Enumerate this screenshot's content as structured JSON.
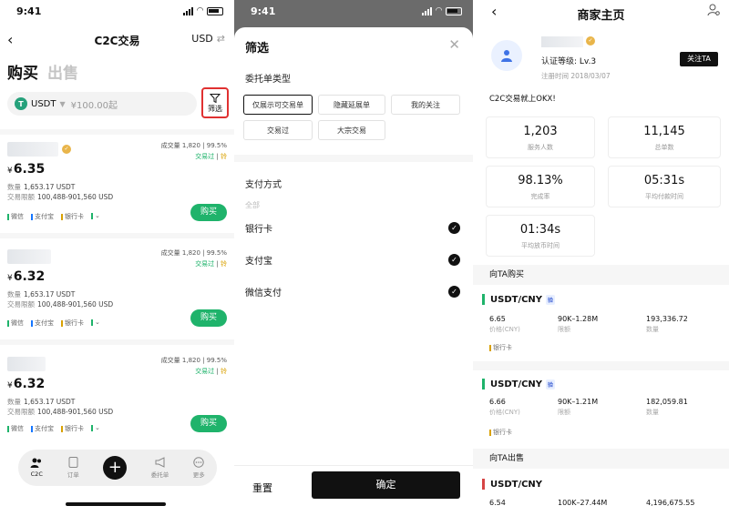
{
  "status": {
    "time": "9:41"
  },
  "list_screen": {
    "title": "C2C交易",
    "currency": "USD",
    "tabs": {
      "buy": "购买",
      "sell": "出售"
    },
    "search": {
      "asset": "USDT",
      "coin_letter": "T",
      "amount_placeholder": "¥100.00起"
    },
    "filter_label": "筛选",
    "ads": [
      {
        "volume": "成交量 1,820",
        "rate": "99.5%",
        "tag1": "交易过",
        "tag2": "铃",
        "currency_symbol": "¥",
        "price": "6.35",
        "qty_label": "数量",
        "qty": "1,653.17 USDT",
        "limit_label": "交易限额",
        "limit": "100,488-901,560 USD",
        "pays": [
          "微信",
          "支付宝",
          "银行卡"
        ],
        "buy": "购买"
      },
      {
        "volume": "成交量 1,820",
        "rate": "99.5%",
        "tag1": "交易过",
        "tag2": "铃",
        "currency_symbol": "¥",
        "price": "6.32",
        "qty_label": "数量",
        "qty": "1,653.17 USDT",
        "limit_label": "交易限额",
        "limit": "100,488-901,560 USD",
        "pays": [
          "微信",
          "支付宝",
          "银行卡"
        ],
        "buy": "购买"
      },
      {
        "volume": "成交量 1,820",
        "rate": "99.5%",
        "tag1": "交易过",
        "tag2": "铃",
        "currency_symbol": "¥",
        "price": "6.32",
        "qty_label": "数量",
        "qty": "1,653.17 USDT",
        "limit_label": "交易限额",
        "limit": "100,488-901,560 USD",
        "pays": [
          "微信",
          "支付宝",
          "银行卡"
        ],
        "buy": "购买"
      }
    ],
    "tabbar": {
      "c2c": "C2C",
      "orders": "订单",
      "ads": "委托单",
      "more": "更多"
    }
  },
  "filter_screen": {
    "title": "筛选",
    "order_type_label": "委托单类型",
    "chips": [
      "仅展示可交易单",
      "隐藏延展单",
      "我的关注",
      "交易过",
      "大宗交易"
    ],
    "payment_label": "支付方式",
    "payment_note": "全部",
    "payments": [
      "银行卡",
      "支付宝",
      "微信支付"
    ],
    "reset": "重置",
    "confirm": "确定"
  },
  "merchant_screen": {
    "title": "商家主页",
    "level_label": "认证等级:",
    "level": "Lv.3",
    "reg_label": "注册时间",
    "reg_date": "2018/03/07",
    "follow": "关注TA",
    "slogan": "C2C交易就上OKX!",
    "stats": [
      {
        "value": "1,203",
        "label": "服务人数"
      },
      {
        "value": "11,145",
        "label": "总单数"
      },
      {
        "value": "98.13%",
        "label": "完成率"
      },
      {
        "value": "05:31s",
        "label": "平均付款时间"
      },
      {
        "value": "01:34s",
        "label": "平均放币时间"
      }
    ],
    "buy_section": "向TA购买",
    "sell_section": "向TA出售",
    "tag": "验",
    "listings": [
      {
        "pair": "USDT/CNY",
        "price": "6.65",
        "price_label": "价格(CNY)",
        "limit": "90K–1.28M",
        "limit_label": "限额",
        "qty": "193,336.72",
        "qty_label": "数量",
        "method": "银行卡"
      },
      {
        "pair": "USDT/CNY",
        "price": "6.66",
        "price_label": "价格(CNY)",
        "limit": "90K–1.21M",
        "limit_label": "限额",
        "qty": "182,059.81",
        "qty_label": "数量",
        "method": "银行卡"
      }
    ],
    "sell_listing": {
      "pair": "USDT/CNY",
      "price": "6.54",
      "limit": "100K–27.44M",
      "qty": "4,196,675.55"
    }
  }
}
